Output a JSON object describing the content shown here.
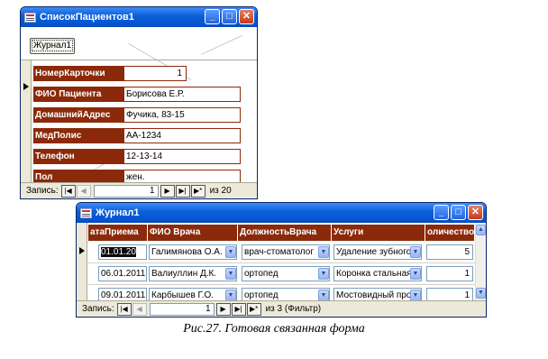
{
  "patients_window": {
    "title": "СписокПациентов1",
    "journal_button": "Журнал1",
    "fields": [
      {
        "label": "НомерКарточки",
        "value": "1"
      },
      {
        "label": "ФИО Пациента",
        "value": "Борисова Е.Р."
      },
      {
        "label": "ДомашнийАдрес",
        "value": "Фучика, 83-15"
      },
      {
        "label": "МедПолис",
        "value": "АА-1234"
      },
      {
        "label": "Телефон",
        "value": "12-13-14"
      },
      {
        "label": "Пол",
        "value": "жен."
      }
    ],
    "nav": {
      "label": "Запись:",
      "current": "1",
      "total_text": "из 20"
    }
  },
  "journal_window": {
    "title": "Журнал1",
    "columns": [
      "атаПриема",
      "ФИО Врача",
      "ДолжностьВрача",
      "Услуги",
      "оличество"
    ],
    "rows": [
      {
        "date": "01.01.20",
        "doctor": "Галимянова О.А.",
        "position": "врач-стоматолог",
        "service": "Удаление зубного",
        "qty": "5"
      },
      {
        "date": "06.01.2011",
        "doctor": "Валиуллин Д.К.",
        "position": "ортопед",
        "service": "Коронка стальная",
        "qty": "1"
      },
      {
        "date": "09.01.2011",
        "doctor": "Карбышев Г.О.",
        "position": "ортопед",
        "service": "Мостовидный прот",
        "qty": "1"
      }
    ],
    "nav": {
      "label": "Запись:",
      "current": "1",
      "total_text": "из 3 (Фильтр)"
    }
  },
  "caption": "Рис.27. Готовая связанная форма",
  "icons": [
    "form-icon",
    "minimize-icon",
    "maximize-icon",
    "close-icon",
    "record-pointer-icon",
    "dropdown-arrow-icon",
    "first-record-icon",
    "prev-record-icon",
    "next-record-icon",
    "last-record-icon",
    "new-record-icon",
    "scroll-up-icon",
    "scroll-down-icon"
  ],
  "colors": {
    "label_bg": "#8b2a0a",
    "title_bar": "#0553cf",
    "window_bg": "#ece9d8"
  }
}
